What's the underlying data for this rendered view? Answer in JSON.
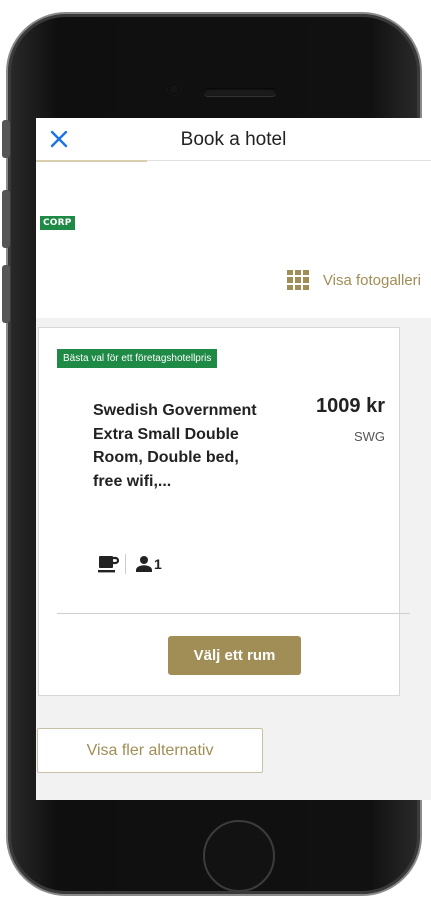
{
  "header": {
    "title": "Book a hotel",
    "close_icon": "close-icon"
  },
  "hotel": {
    "corp_label": "CORP",
    "gallery_label": "Visa fotogalleri",
    "gallery_icon": "grid-icon"
  },
  "offer": {
    "badge": "Bästa val för ett företagshotellpris",
    "room_name": "Swedish Government Extra Small Double Room, Double bed, free wifi,...",
    "price": "1009 kr",
    "rate_code": "SWG",
    "breakfast_icon": "coffee-cup-icon",
    "guest_icon": "person-icon",
    "guests": "1",
    "select_label": "Välj ett rum"
  },
  "more_options_label": "Visa fler alternativ",
  "colors": {
    "accent": "#a18d56",
    "badge_green": "#1f8a45",
    "close_blue": "#1a73e8"
  }
}
